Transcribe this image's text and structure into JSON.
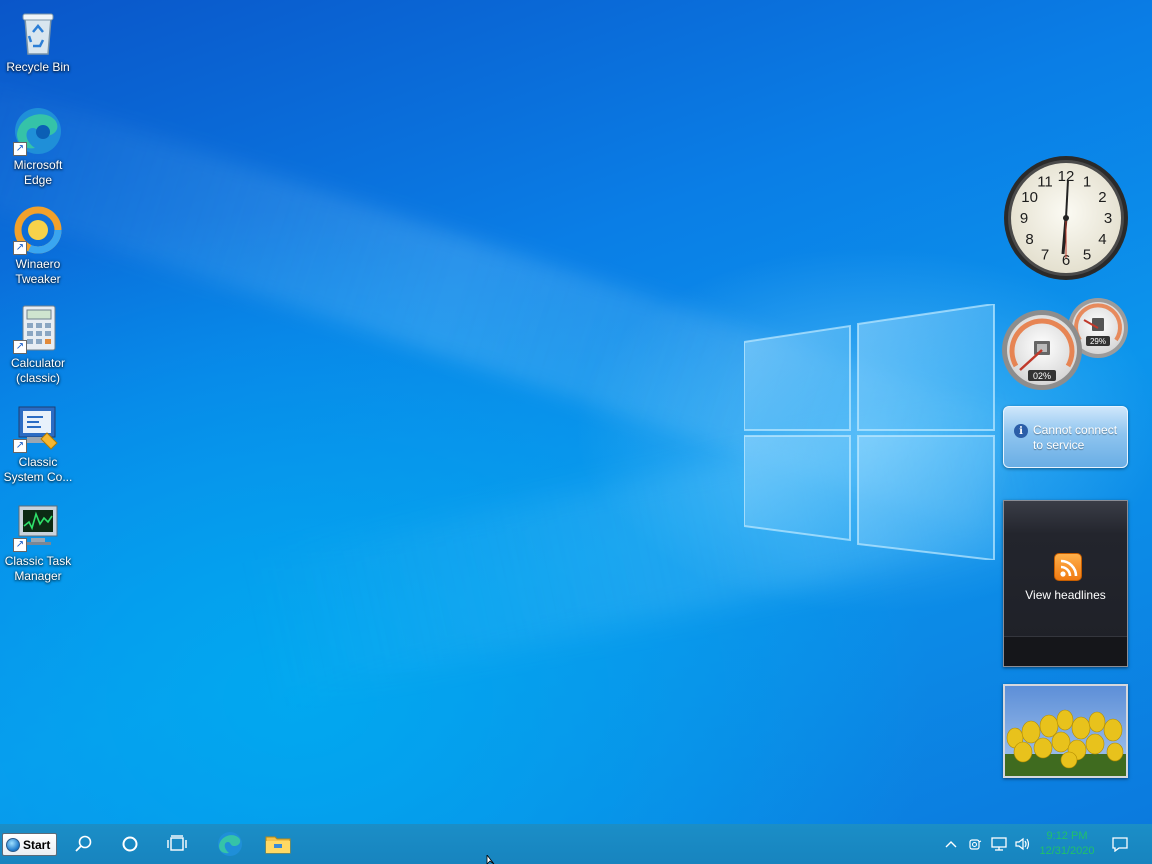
{
  "desktop": {
    "icons": [
      {
        "label": "Recycle Bin",
        "icon": "recycle-bin-icon"
      },
      {
        "label": "Microsoft Edge",
        "icon": "edge-icon"
      },
      {
        "label": "Winaero Tweaker",
        "icon": "winaero-tweaker-icon"
      },
      {
        "label": "Calculator (classic)",
        "icon": "calculator-icon"
      },
      {
        "label": "Classic System Co...",
        "icon": "system-control-icon"
      },
      {
        "label": "Classic Task Manager",
        "icon": "task-manager-icon"
      }
    ]
  },
  "gadgets": {
    "clock": {
      "hour_numbers": [
        "12",
        "1",
        "2",
        "3",
        "4",
        "5",
        "6",
        "7",
        "8",
        "9",
        "10",
        "11"
      ]
    },
    "cpu_meter": {
      "cpu": "02%",
      "memory": "29%"
    },
    "weather": {
      "message": "Cannot connect to service"
    },
    "feed": {
      "label": "View headlines"
    },
    "slideshow": {
      "image": "yellow tulips"
    }
  },
  "taskbar": {
    "start_label": "Start",
    "buttons": [
      "search-icon",
      "cortana-icon",
      "task-view-icon",
      "edge-icon",
      "file-explorer-icon"
    ],
    "tray": [
      "show-hidden-icons-chevron",
      "meet-now-icon",
      "network-icon",
      "volume-icon"
    ],
    "time": "9:12 PM",
    "date": "12/31/2020",
    "notification": "action-center-icon"
  },
  "colors": {
    "wallpaper": "#0a7ee6",
    "taskbar": "#1784bf",
    "tray_clock_text": "#20c06a"
  }
}
